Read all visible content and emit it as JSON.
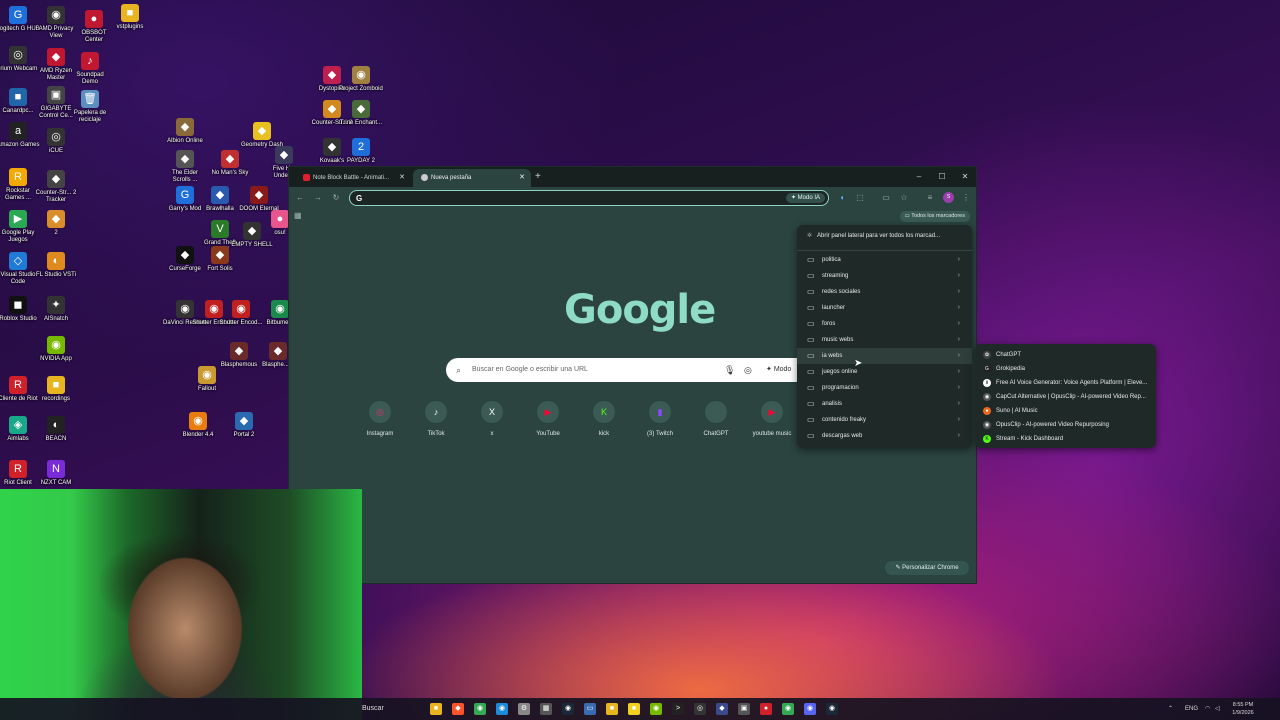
{
  "desktop": {
    "icons": [
      {
        "label": "Logitech G HUB",
        "color": "#1e6fd9",
        "glyph": "G"
      },
      {
        "label": "AMD Privacy View",
        "color": "#333333",
        "glyph": "◉"
      },
      {
        "label": "OBSBOT Center",
        "color": "#c01830",
        "glyph": "●"
      },
      {
        "label": "vstplugins",
        "color": "#e8b520",
        "glyph": "■"
      },
      {
        "label": "Irium Webcam",
        "color": "#333333",
        "glyph": "◎"
      },
      {
        "label": "AMD Ryzen Master",
        "color": "#c01830",
        "glyph": "◆"
      },
      {
        "label": "Soundpad Demo",
        "color": "#c01830",
        "glyph": "♪"
      },
      {
        "label": "Canardpc...",
        "color": "#2266aa",
        "glyph": "■"
      },
      {
        "label": "GIGABYTE Control Ce...",
        "color": "#444444",
        "glyph": "▣"
      },
      {
        "label": "Papelera de reciclaje",
        "color": "#5a8fc0",
        "glyph": "🗑"
      },
      {
        "label": "Amazon Games",
        "color": "#222222",
        "glyph": "a"
      },
      {
        "label": "iCUE",
        "color": "#333333",
        "glyph": "◎"
      },
      {
        "label": "Rockstar Games ...",
        "color": "#f2a900",
        "glyph": "R"
      },
      {
        "label": "Counter-Str... 2 Tracker",
        "color": "#444444",
        "glyph": "◆"
      },
      {
        "label": "Google Play Juegos",
        "color": "#2aa853",
        "glyph": "▶"
      },
      {
        "label": "2",
        "color": "#d98e2a",
        "glyph": "◆"
      },
      {
        "label": "Visual Studio Code",
        "color": "#1f7ad8",
        "glyph": "◇"
      },
      {
        "label": "FL Studio VSTi",
        "color": "#e08a1e",
        "glyph": "◐"
      },
      {
        "label": "Roblox Studio",
        "color": "#111111",
        "glyph": "◼"
      },
      {
        "label": "AlSnatch",
        "color": "#333333",
        "glyph": "✦"
      },
      {
        "label": "NVIDIA App",
        "color": "#76b900",
        "glyph": "◉"
      },
      {
        "label": "Cliente de Riot",
        "color": "#d0202a",
        "glyph": "R"
      },
      {
        "label": "recordings",
        "color": "#e8b520",
        "glyph": "■"
      },
      {
        "label": "Aimlabs",
        "color": "#1aa88a",
        "glyph": "◈"
      },
      {
        "label": "BEACN",
        "color": "#222222",
        "glyph": "◐"
      },
      {
        "label": "Riot Client",
        "color": "#d0202a",
        "glyph": "R"
      },
      {
        "label": "NZXT CAM",
        "color": "#7a2bd8",
        "glyph": "N"
      },
      {
        "label": "Albion Online",
        "color": "#8a6a3a",
        "glyph": "◆"
      },
      {
        "label": "Geometry Dash",
        "color": "#e8c020",
        "glyph": "◆"
      },
      {
        "label": "Dystopika",
        "color": "#c02050",
        "glyph": "◆"
      },
      {
        "label": "Project Zomboid",
        "color": "#a08040",
        "glyph": "◉"
      },
      {
        "label": "The Elder Scrolls ...",
        "color": "#555555",
        "glyph": "◆"
      },
      {
        "label": "No Man's Sky",
        "color": "#c03030",
        "glyph": "◆"
      },
      {
        "label": "Five H... Under...",
        "color": "#3a3a5a",
        "glyph": "◆"
      },
      {
        "label": "Counter-Str... 2",
        "color": "#d08a20",
        "glyph": "◆"
      },
      {
        "label": "Trine Enchant...",
        "color": "#4a6a3a",
        "glyph": "◆"
      },
      {
        "label": "Garry's Mod",
        "color": "#1e6fd9",
        "glyph": "G"
      },
      {
        "label": "Brawlhalla",
        "color": "#2a5ab0",
        "glyph": "◆"
      },
      {
        "label": "DOOM Eternal",
        "color": "#8a1a1a",
        "glyph": "◆"
      },
      {
        "label": "osu!",
        "color": "#e8558c",
        "glyph": "●"
      },
      {
        "label": "Kovaak's",
        "color": "#333333",
        "glyph": "◆"
      },
      {
        "label": "PAYDAY 2",
        "color": "#1e6fd9",
        "glyph": "2"
      },
      {
        "label": "Grand Theft Auto V",
        "color": "#2a7a2a",
        "glyph": "V"
      },
      {
        "label": "EMPTY SHELL",
        "color": "#333333",
        "glyph": "◆"
      },
      {
        "label": "CurseForge",
        "color": "#111111",
        "glyph": "◆"
      },
      {
        "label": "Fort Solis",
        "color": "#8a3a1a",
        "glyph": "◆"
      },
      {
        "label": "DaVinci Resolve",
        "color": "#333333",
        "glyph": "◉"
      },
      {
        "label": "Shutter Encoder",
        "color": "#c02020",
        "glyph": "◉"
      },
      {
        "label": "Shutter Encod...",
        "color": "#c02020",
        "glyph": "◉"
      },
      {
        "label": "Bitbume...",
        "color": "#1a8a4a",
        "glyph": "◉"
      },
      {
        "label": "Blasphemous",
        "color": "#6a2a2a",
        "glyph": "◆"
      },
      {
        "label": "Blasphe... 2",
        "color": "#6a2a2a",
        "glyph": "◆"
      },
      {
        "label": "Fallout",
        "color": "#c89a30",
        "glyph": "◉"
      },
      {
        "label": "Blender 4.4",
        "color": "#e87d0d",
        "glyph": "◉"
      },
      {
        "label": "Portal 2",
        "color": "#2a6ab0",
        "glyph": "◆"
      }
    ]
  },
  "browser": {
    "tabs": [
      {
        "label": "Note Block Battle - Animati...",
        "favicon_color": "#e21e2b"
      },
      {
        "label": "Nueva pestaña",
        "favicon_color": "#cccccc"
      }
    ],
    "new_tab_icon": "+",
    "window_controls": {
      "minimize": "–",
      "maximize": "☐",
      "close": "✕"
    },
    "toolbar": {
      "back": "←",
      "forward": "→",
      "reload": "↻",
      "omnibox_g": "G",
      "omnibox_value": "",
      "modo_ia_label": "Modo IA",
      "profile_initial": "S"
    },
    "bookmarks_bar": {
      "all_bookmarks_label": "Todos los marcadores"
    },
    "ntp": {
      "logo": "Google",
      "search_placeholder": "Buscar en Google o escribir una URL",
      "search_modo": "Modo",
      "shortcuts": [
        {
          "label": "Instagram",
          "icon": "instagram-icon",
          "color": "#e1306c",
          "glyph": "◎"
        },
        {
          "label": "TikTok",
          "icon": "tiktok-icon",
          "color": "#111111",
          "glyph": "♪"
        },
        {
          "label": "x",
          "icon": "x-icon",
          "color": "#111111",
          "glyph": "X"
        },
        {
          "label": "YouTube",
          "icon": "youtube-icon",
          "color": "#ff0033",
          "glyph": "▶"
        },
        {
          "label": "kick",
          "icon": "kick-icon",
          "color": "#53fc18",
          "glyph": "K"
        },
        {
          "label": "(3) Twitch",
          "icon": "twitch-icon",
          "color": "#9146ff",
          "glyph": "▮"
        },
        {
          "label": "ChatGPT",
          "icon": "chatgpt-icon",
          "color": "#3c5b55",
          "glyph": "✿"
        },
        {
          "label": "youtube music",
          "icon": "youtube-music-icon",
          "color": "#ff0033",
          "glyph": "▶"
        }
      ],
      "customize_label": "Personalizar Chrome"
    },
    "bookmarks_menu": {
      "header": "Abrir panel lateral para ver todos los marcad...",
      "folders": [
        {
          "label": "politica"
        },
        {
          "label": "streaming"
        },
        {
          "label": "redes sociales"
        },
        {
          "label": "launcher"
        },
        {
          "label": "foros"
        },
        {
          "label": "music webs"
        },
        {
          "label": "ia webs"
        },
        {
          "label": "juegos online"
        },
        {
          "label": "programacion"
        },
        {
          "label": "analisis"
        },
        {
          "label": "contenido freaky"
        },
        {
          "label": "descargas web"
        }
      ],
      "hovered_folder": "ia webs"
    },
    "ia_webs_submenu": [
      {
        "label": "ChatGPT",
        "icon": "chatgpt-icon",
        "color": "#444444",
        "glyph": "✿"
      },
      {
        "label": "Grokipedia",
        "icon": "grok-icon",
        "color": "#222222",
        "glyph": "G"
      },
      {
        "label": "Free AI Voice Generator: Voice Agents Platform | Eleve...",
        "icon": "elevenlabs-icon",
        "color": "#ffffff",
        "glyph": "Ⅱ"
      },
      {
        "label": "CapCut Alternative | OpusClip - AI-powered Video Rep...",
        "icon": "opusclip-icon",
        "color": "#555555",
        "glyph": "◉"
      },
      {
        "label": "Suno | AI Music",
        "icon": "suno-icon",
        "color": "#e86a1e",
        "glyph": "●"
      },
      {
        "label": "OpusClip - AI-powered Video Repurposing",
        "icon": "opusclip-icon",
        "color": "#555555",
        "glyph": "◉"
      },
      {
        "label": "Stream - Kick Dashboard",
        "icon": "kick-icon",
        "color": "#53fc18",
        "glyph": "K"
      }
    ]
  },
  "taskbar": {
    "search_label": "Buscar",
    "apps": [
      {
        "icon": "file-explorer-icon",
        "color": "#e8b520",
        "glyph": "■"
      },
      {
        "icon": "brave-icon",
        "color": "#fb542b",
        "glyph": "◆"
      },
      {
        "icon": "chrome-icon",
        "color": "#34a853",
        "glyph": "◉"
      },
      {
        "icon": "edge-icon",
        "color": "#1e8bd8",
        "glyph": "◉"
      },
      {
        "icon": "settings-icon",
        "color": "#888888",
        "glyph": "⚙"
      },
      {
        "icon": "calculator-icon",
        "color": "#555555",
        "glyph": "▦"
      },
      {
        "icon": "steam-icon",
        "color": "#1b2838",
        "glyph": "◉"
      },
      {
        "icon": "screen-icon",
        "color": "#3a6ab0",
        "glyph": "▭"
      },
      {
        "icon": "folder-icon",
        "color": "#e8b520",
        "glyph": "■"
      },
      {
        "icon": "notes-icon",
        "color": "#f0d020",
        "glyph": "■"
      },
      {
        "icon": "nvidia-icon",
        "color": "#76b900",
        "glyph": "◉"
      },
      {
        "icon": "terminal-icon",
        "color": "#222222",
        "glyph": ">"
      },
      {
        "icon": "obs-icon",
        "color": "#333333",
        "glyph": "◎"
      },
      {
        "icon": "vpn-icon",
        "color": "#3a4a8a",
        "glyph": "◆"
      },
      {
        "icon": "app-icon",
        "color": "#555555",
        "glyph": "▣"
      },
      {
        "icon": "record-icon",
        "color": "#d0202a",
        "glyph": "●"
      },
      {
        "icon": "chrome-active-icon",
        "color": "#34a853",
        "glyph": "◉"
      },
      {
        "icon": "discord-icon",
        "color": "#5865f2",
        "glyph": "◉"
      },
      {
        "icon": "steam2-icon",
        "color": "#1b2838",
        "glyph": "◉"
      }
    ],
    "tray": {
      "language": "ENG",
      "time": "8:55 PM",
      "date": "1/9/2026"
    }
  }
}
